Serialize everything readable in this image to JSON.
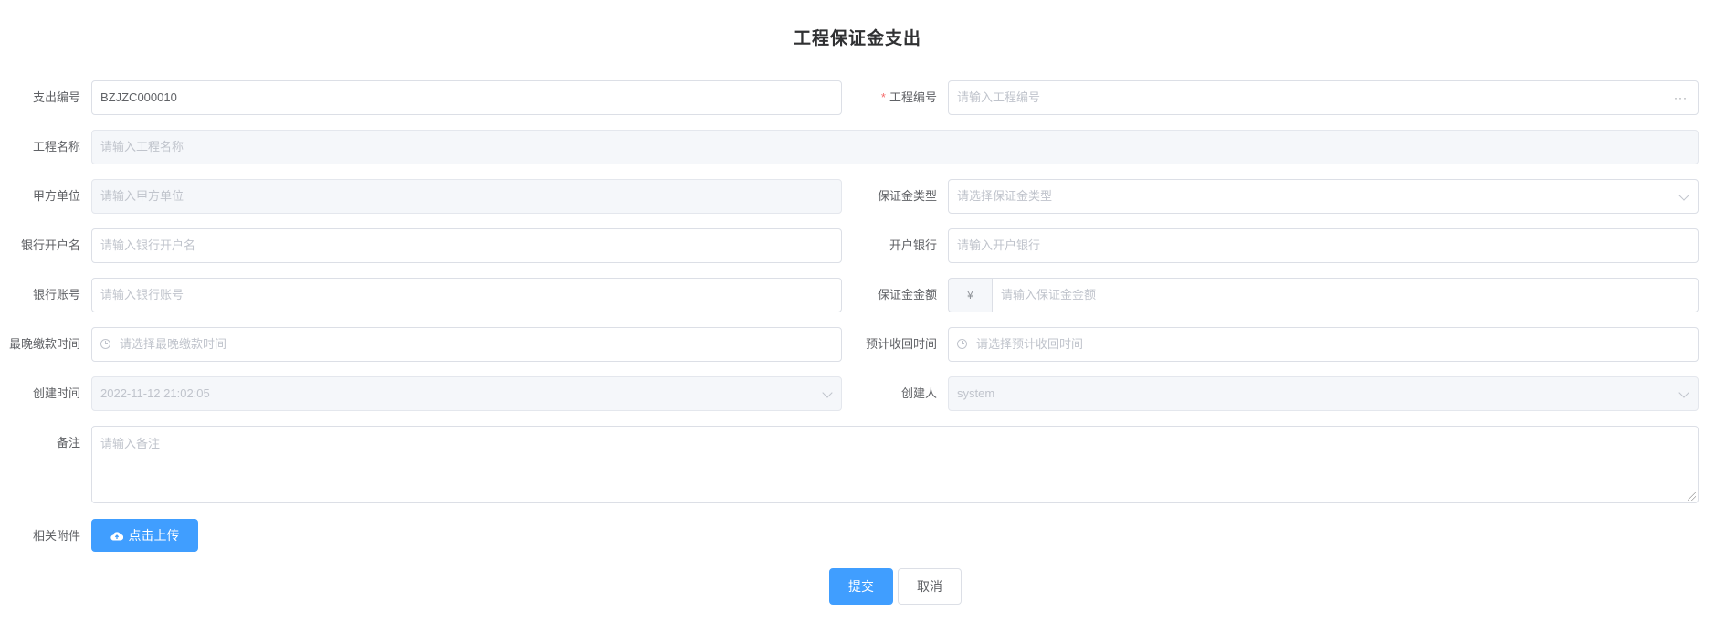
{
  "title": "工程保证金支出",
  "fields": {
    "expense_no": {
      "label": "支出编号",
      "value": "BZJZC000010"
    },
    "project_no": {
      "label": "工程编号",
      "placeholder": "请输入工程编号",
      "more": "···"
    },
    "project_name": {
      "label": "工程名称",
      "placeholder": "请输入工程名称"
    },
    "party_a": {
      "label": "甲方单位",
      "placeholder": "请输入甲方单位"
    },
    "deposit_type": {
      "label": "保证金类型",
      "placeholder": "请选择保证金类型"
    },
    "account_name": {
      "label": "银行开户名",
      "placeholder": "请输入银行开户名"
    },
    "bank": {
      "label": "开户银行",
      "placeholder": "请输入开户银行"
    },
    "account_no": {
      "label": "银行账号",
      "placeholder": "请输入银行账号"
    },
    "amount": {
      "label": "保证金金额",
      "prefix": "¥",
      "placeholder": "请输入保证金金额"
    },
    "latest_pay_time": {
      "label": "最晚缴款时间",
      "placeholder": "请选择最晚缴款时间"
    },
    "expected_return_time": {
      "label": "预计收回时间",
      "placeholder": "请选择预计收回时间"
    },
    "create_time": {
      "label": "创建时间",
      "value": "2022-11-12 21:02:05"
    },
    "creator": {
      "label": "创建人",
      "value": "system"
    },
    "remark": {
      "label": "备注",
      "placeholder": "请输入备注"
    },
    "attachment": {
      "label": "相关附件",
      "button": "点击上传"
    }
  },
  "actions": {
    "submit": "提交",
    "cancel": "取消"
  },
  "colors": {
    "primary": "#409eff",
    "required": "#f56c6c",
    "border": "#dcdfe6",
    "disabled_bg": "#f5f7fa"
  },
  "icons": [
    "more-icon",
    "chevron-down-icon",
    "clock-icon",
    "upload-cloud-icon",
    "resize-handle-icon"
  ]
}
